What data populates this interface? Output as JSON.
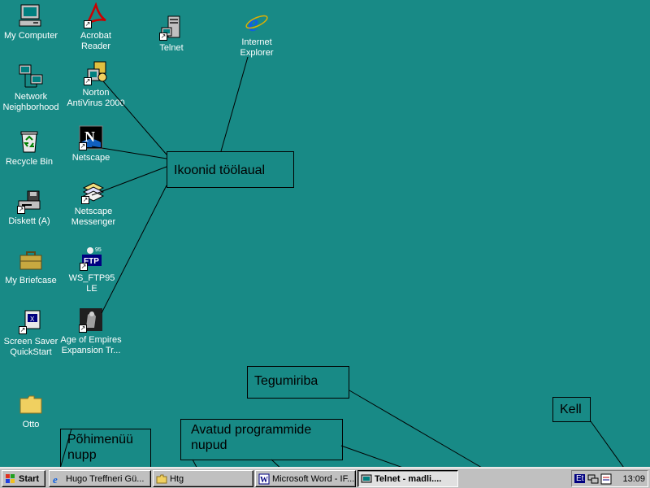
{
  "desktop": {
    "background_color": "#188a86",
    "icons": [
      {
        "label": "My Computer",
        "icon": "computer-icon"
      },
      {
        "label": "Network\nNeighborhood",
        "icon": "network-icon"
      },
      {
        "label": "Recycle Bin",
        "icon": "recycle-bin-icon"
      },
      {
        "label": "Diskett (A)",
        "icon": "floppy-drive-icon"
      },
      {
        "label": "My Briefcase",
        "icon": "briefcase-icon"
      },
      {
        "label": "Screen Saver\nQuickStart",
        "icon": "screensaver-icon"
      },
      {
        "label": "Otto",
        "icon": "folder-icon"
      },
      {
        "label": "Acrobat\nReader",
        "icon": "acrobat-icon"
      },
      {
        "label": "Norton\nAntiVirus 2000",
        "icon": "norton-icon"
      },
      {
        "label": "Netscape",
        "icon": "netscape-icon"
      },
      {
        "label": "Netscape\nMessenger",
        "icon": "messenger-icon"
      },
      {
        "label": "WS_FTP95\nLE",
        "icon": "ftp-icon"
      },
      {
        "label": "Age of Empires\nExpansion Tr...",
        "icon": "age-of-empires-icon"
      },
      {
        "label": "Telnet",
        "icon": "telnet-icon"
      },
      {
        "label": "Internet\nExplorer",
        "icon": "internet-explorer-icon"
      }
    ]
  },
  "annotations": {
    "icons_label": "Ikoonid töölaual",
    "taskbar_label": "Tegumiriba",
    "clock_label": "Kell",
    "start_label": "Põhimenüü\nnupp",
    "open_programs_label": "Avatud programmide\nnupud"
  },
  "taskbar": {
    "start_label": "Start",
    "buttons": [
      {
        "label": "Hugo Treffneri Gü...",
        "icon": "ie-icon",
        "active": false
      },
      {
        "label": "Htg",
        "icon": "folder-icon",
        "active": false
      },
      {
        "label": "Microsoft Word - IF...",
        "icon": "word-icon",
        "active": false
      },
      {
        "label": "Telnet - madli....",
        "icon": "telnet-icon",
        "active": true
      }
    ],
    "tray": {
      "language": "Et",
      "clock": "13:09"
    }
  }
}
